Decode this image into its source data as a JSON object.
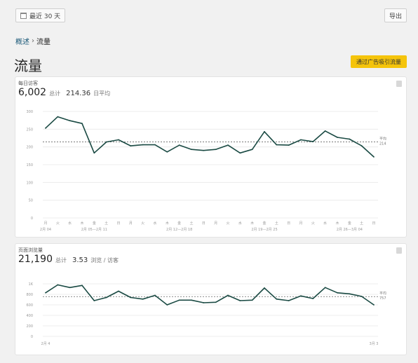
{
  "toolbar": {
    "date_range_label": "最近 30 天",
    "export_label": "导出"
  },
  "breadcrumb": {
    "parent": "概述",
    "separator": "›",
    "current": "流量"
  },
  "page": {
    "title": "流量",
    "promote_label": "通过广告吸引流量"
  },
  "colors": {
    "line": "#1a4a43",
    "accent_button": "#f5c40b"
  },
  "visitors_card": {
    "label": "每日访客",
    "total": "6,002",
    "total_suffix": "总计",
    "average": "214.36",
    "average_suffix": "日平均",
    "chart_data": {
      "type": "line",
      "series": [
        {
          "values": [
            253,
            285,
            274,
            266,
            183,
            214,
            220,
            203,
            206,
            206,
            186,
            205,
            193,
            190,
            193,
            205,
            183,
            193,
            243,
            206,
            205,
            220,
            215,
            245,
            227,
            222,
            203,
            172
          ]
        }
      ],
      "ylim": [
        0,
        300
      ],
      "yticks": [
        "0",
        "50",
        "100",
        "150",
        "200",
        "250",
        "300"
      ],
      "weekday_labels": [
        "月",
        "火",
        "水",
        "木",
        "金",
        "土",
        "日",
        "月",
        "火",
        "水",
        "木",
        "金",
        "土",
        "日",
        "月",
        "火",
        "水",
        "木",
        "金",
        "土",
        "日",
        "月",
        "火",
        "水",
        "木",
        "金",
        "土",
        "日"
      ],
      "week_ranges": [
        {
          "label": "2月 04",
          "at": 0
        },
        {
          "label": "2月 05—2月 11",
          "at": 4
        },
        {
          "label": "2月 12—2月 18",
          "at": 11
        },
        {
          "label": "2月 19—2月 25",
          "at": 18
        },
        {
          "label": "2月 26—3月 04",
          "at": 25
        }
      ],
      "average": {
        "label": "平均",
        "value": "214"
      }
    }
  },
  "pageviews_card": {
    "label": "页面浏览量",
    "total": "21,190",
    "total_suffix": "总计",
    "average": "3.53",
    "average_suffix": "浏览 / 访客",
    "chart_data": {
      "type": "line",
      "series": [
        {
          "values": [
            830,
            980,
            930,
            970,
            680,
            740,
            860,
            740,
            710,
            780,
            600,
            690,
            690,
            640,
            650,
            780,
            680,
            690,
            920,
            710,
            680,
            770,
            720,
            930,
            830,
            810,
            760,
            600
          ]
        }
      ],
      "ylim": [
        0,
        1000
      ],
      "yticks": [
        "0",
        "200",
        "400",
        "600",
        "800",
        "1K"
      ],
      "x_start": "2月 4",
      "x_end": "3月 3",
      "average": {
        "label": "平均",
        "value": "757"
      }
    }
  }
}
